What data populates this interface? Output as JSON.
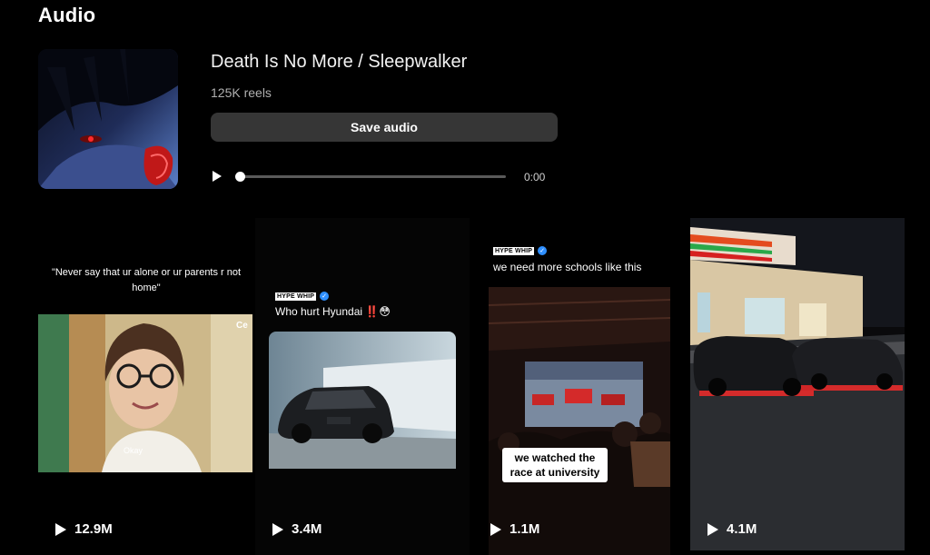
{
  "page": {
    "title": "Audio"
  },
  "audio": {
    "track_title": "Death Is No More / Sleepwalker",
    "reel_count": "125K reels",
    "save_label": "Save audio",
    "time": "0:00",
    "progress": 0.0
  },
  "reels": [
    {
      "quote": "\"Never say that ur alone or ur parents r not home\"",
      "frame_corner_text": "Ce",
      "frame_subtitle": "Okay",
      "views": "12.9M"
    },
    {
      "badge": "HYPE WHIP",
      "caption": "Who hurt Hyundai ‼️😳",
      "views": "3.4M"
    },
    {
      "badge": "HYPE WHIP",
      "caption": "we need more schools like this",
      "subtitle": "we watched the race at university",
      "views": "1.1M"
    },
    {
      "views": "4.1M"
    }
  ],
  "colors": {
    "background": "#000000",
    "button": "#363636",
    "verified": "#2f8fff"
  }
}
